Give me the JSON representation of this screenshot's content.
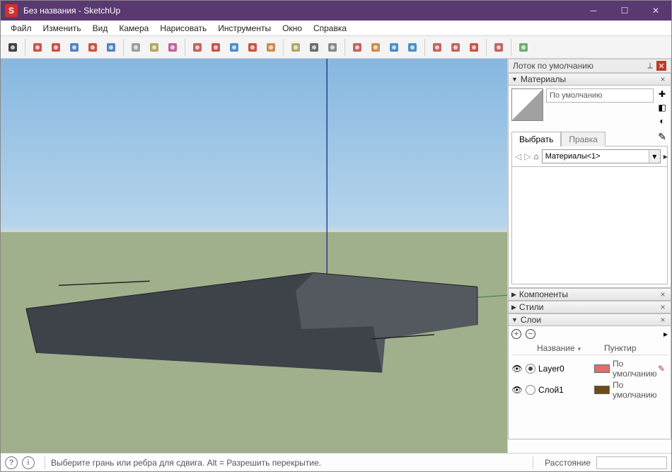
{
  "title": "Без названия - SketchUp",
  "app_icon_letter": "S",
  "menu": [
    "Файл",
    "Изменить",
    "Вид",
    "Камера",
    "Нарисовать",
    "Инструменты",
    "Окно",
    "Справка"
  ],
  "toolbar_icons": [
    {
      "name": "select-icon"
    },
    {
      "sep": true
    },
    {
      "name": "line-icon"
    },
    {
      "name": "freehand-icon"
    },
    {
      "name": "rectangle-icon"
    },
    {
      "name": "arc-icon"
    },
    {
      "name": "circle-icon"
    },
    {
      "sep": true
    },
    {
      "name": "eraser-icon"
    },
    {
      "name": "tape-icon"
    },
    {
      "name": "paint-icon"
    },
    {
      "sep": true
    },
    {
      "name": "pushpull-icon"
    },
    {
      "name": "offset-icon"
    },
    {
      "name": "move-icon"
    },
    {
      "name": "rotate-icon"
    },
    {
      "name": "scale-icon"
    },
    {
      "sep": true
    },
    {
      "name": "tape2-icon"
    },
    {
      "name": "text-icon"
    },
    {
      "name": "dim-icon"
    },
    {
      "sep": true
    },
    {
      "name": "orbit-icon"
    },
    {
      "name": "pan-icon"
    },
    {
      "name": "zoom-icon"
    },
    {
      "name": "zoomext-icon"
    },
    {
      "sep": true
    },
    {
      "name": "warehouse-icon"
    },
    {
      "name": "extensions-icon"
    },
    {
      "name": "layers-icon"
    },
    {
      "sep": true
    },
    {
      "name": "addloc-icon"
    },
    {
      "sep": true
    },
    {
      "name": "user-icon"
    }
  ],
  "tray": {
    "title": "Лоток по умолчанию",
    "materials": {
      "header": "Материалы",
      "name": "По умолчанию",
      "tabs": {
        "select": "Выбрать",
        "edit": "Правка"
      },
      "dropdown": "Материалы<1>"
    },
    "components": {
      "header": "Компоненты"
    },
    "styles": {
      "header": "Стили"
    },
    "layers": {
      "header": "Слои",
      "cols": {
        "name": "Название",
        "dash": "Пунктир"
      },
      "rows": [
        {
          "name": "Layer0",
          "color": "#e46c6c",
          "dash": "По умолчанию",
          "selected": true,
          "pen": true
        },
        {
          "name": "Слой1",
          "color": "#6b4e16",
          "dash": "По умолчанию",
          "selected": false,
          "pen": false
        }
      ]
    }
  },
  "status": {
    "hint": "Выберите грань или ребра для сдвига. Alt = Разрешить перекрытие.",
    "distance_label": "Расстояние"
  }
}
